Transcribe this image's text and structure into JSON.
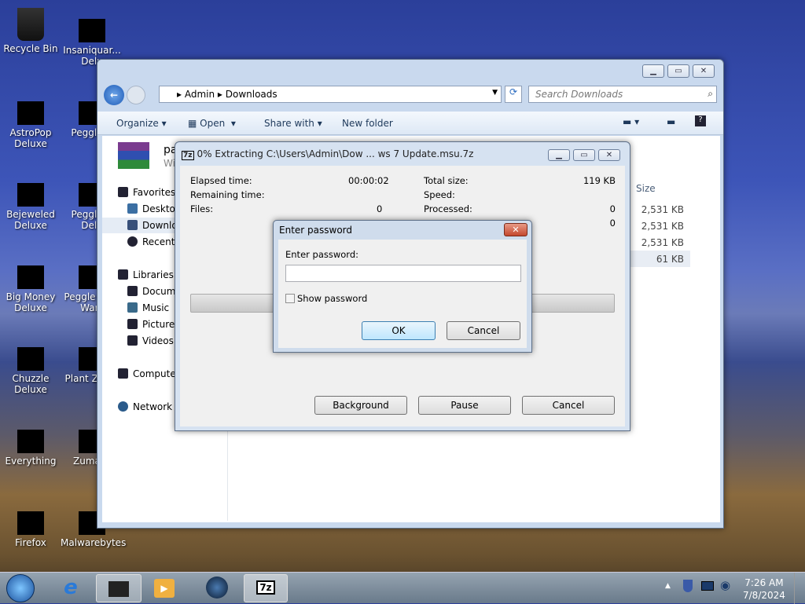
{
  "desktop": {
    "icons": [
      {
        "label": "Recycle Bin"
      },
      {
        "label": "Insaniquar... Delu"
      },
      {
        "label": "AstroPop Deluxe"
      },
      {
        "label": "Peggle D"
      },
      {
        "label": "Bejeweled Deluxe"
      },
      {
        "label": "Peggle N Delu"
      },
      {
        "label": "Big Money Deluxe"
      },
      {
        "label": "Peggle W of Warc"
      },
      {
        "label": "Chuzzle Deluxe"
      },
      {
        "label": "Plant Zomb"
      },
      {
        "label": "Everything"
      },
      {
        "label": "Zuma D"
      },
      {
        "label": "Firefox"
      },
      {
        "label": "Malwarebytes"
      }
    ]
  },
  "explorer": {
    "breadcrumb": [
      "Admin",
      "Downloads"
    ],
    "search_placeholder": "Search Downloads",
    "toolbar": {
      "organize": "Organize",
      "open": "Open",
      "share": "Share with",
      "new_folder": "New folder"
    },
    "file_header": {
      "name": "pa",
      "sub": "Wi"
    },
    "nav": {
      "favorites": "Favorites",
      "desktop": "Desktop",
      "downloads": "Downlo",
      "recent": "Recent P",
      "libraries": "Libraries",
      "documents": "Docume",
      "music": "Music",
      "pictures": "Pictures",
      "videos": "Videos",
      "computer": "Compute",
      "network": "Network"
    },
    "column_size": "Size",
    "sizes": [
      "2,531 KB",
      "2,531 KB",
      "2,531 KB",
      "61 KB"
    ]
  },
  "extract": {
    "title": "0% Extracting C:\\Users\\Admin\\Dow ... ws 7 Update.msu.7z",
    "app_icon": "7z",
    "elapsed_label": "Elapsed time:",
    "elapsed": "00:00:02",
    "remaining_label": "Remaining time:",
    "files_label": "Files:",
    "files": "0",
    "total_label": "Total size:",
    "total": "119 KB",
    "speed_label": "Speed:",
    "processed_label": "Processed:",
    "processed": "0",
    "extra": "0",
    "progress": 0,
    "background": "Background",
    "pause": "Pause",
    "cancel": "Cancel"
  },
  "password": {
    "title": "Enter password",
    "label": "Enter password:",
    "value": "",
    "show": "Show password",
    "show_checked": false,
    "ok": "OK",
    "cancel": "Cancel"
  },
  "taskbar": {
    "time": "7:26 AM",
    "date": "7/8/2024",
    "app_7z": "7z"
  }
}
